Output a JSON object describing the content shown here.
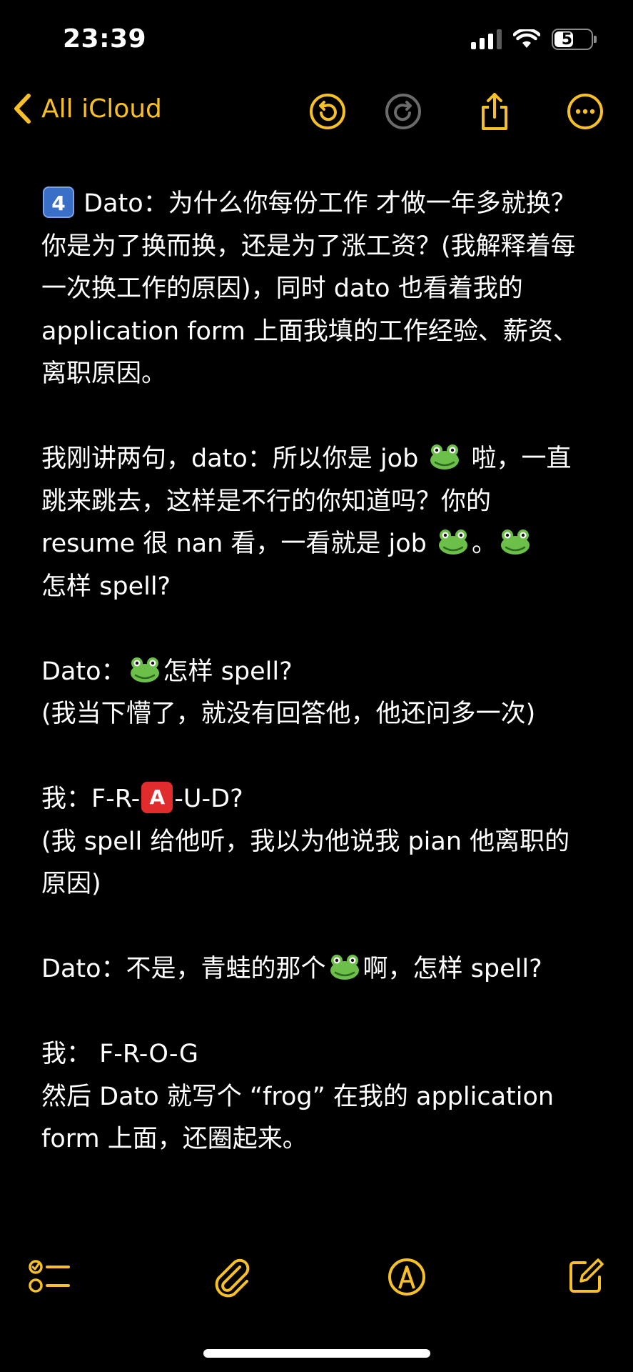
{
  "status": {
    "time": "23:39",
    "battery": "51",
    "battery_fraction": 0.51
  },
  "nav": {
    "back_label": "All iCloud",
    "icons": [
      "chevron-left-icon",
      "undo-icon",
      "redo-icon",
      "share-icon",
      "more-icon"
    ]
  },
  "note": {
    "p1": {
      "keycap": "4",
      "text": " Dato：为什么你每份工作 才做一年多就换？你是为了换而换，还是为了涨工资？(我解释着每一次换工作的原因)，同时 dato 也看着我的 application form 上面我填的工作经验、薪资、离职原因。"
    },
    "p2": {
      "a": "我刚讲两句，dato：所以你是 job ",
      "b": " 啦，一直跳来跳去，这样是不行的你知道吗？你的 resume 很 nan 看，一看就是 job ",
      "c": "。",
      "d": "怎样 spell?"
    },
    "p3": {
      "a": "Dato：",
      "b": "怎样 spell?",
      "c": "(我当下懵了，就没有回答他，他还问多一次)"
    },
    "p4": {
      "a": "我：F-R-",
      "abox": "A",
      "b": "-U-D?",
      "c": "(我 spell 给他听，我以为他说我 pian 他离职的原因)"
    },
    "p5": {
      "a": "Dato：不是，青蛙的那个",
      "b": "啊，怎样 spell?"
    },
    "p6": {
      "a": "我： F-R-O-G",
      "b": "然后 Dato 就写个 “frog” 在我的 application form 上面，还圈起来。"
    }
  },
  "toolbar": {
    "icons": [
      "checklist-icon",
      "paperclip-icon",
      "markup-icon",
      "compose-icon"
    ]
  },
  "colors": {
    "accent": "#f6c026",
    "background": "#000000",
    "text": "#ffffff",
    "disabled": "#6b6b6b"
  }
}
